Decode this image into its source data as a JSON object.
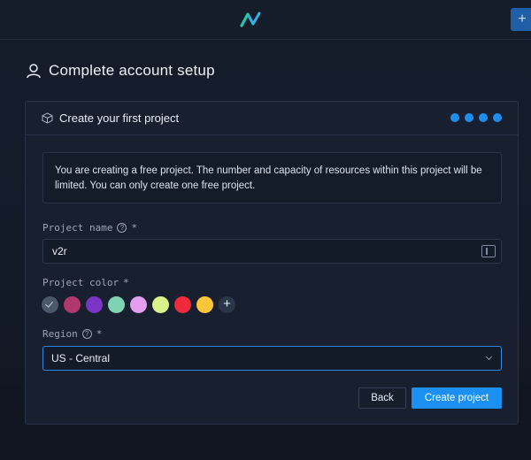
{
  "topbar": {
    "logo_icon": "logo-icon",
    "add_label": "+"
  },
  "page": {
    "title": "Complete account setup",
    "user_icon": "user-icon"
  },
  "card": {
    "title": "Create your first project",
    "steps": {
      "total": 4,
      "accent": "#1d8ff0"
    },
    "notice": "You are creating a free project. The number and capacity of resources within this project will be limited. You can only create one free project.",
    "fields": {
      "project_name": {
        "label": "Project name",
        "required": "*",
        "value": "v2r"
      },
      "project_color": {
        "label": "Project color",
        "required": "*",
        "swatches": [
          "#4b576c",
          "#b1386c",
          "#7a34c6",
          "#7fd3b5",
          "#e39ef0",
          "#d9f28a",
          "#ee2a3c",
          "#fcc63a"
        ],
        "selected_index": 0,
        "add_label": "+"
      },
      "region": {
        "label": "Region",
        "required": "*",
        "value": "US - Central"
      }
    },
    "buttons": {
      "back": "Back",
      "create": "Create project"
    }
  }
}
